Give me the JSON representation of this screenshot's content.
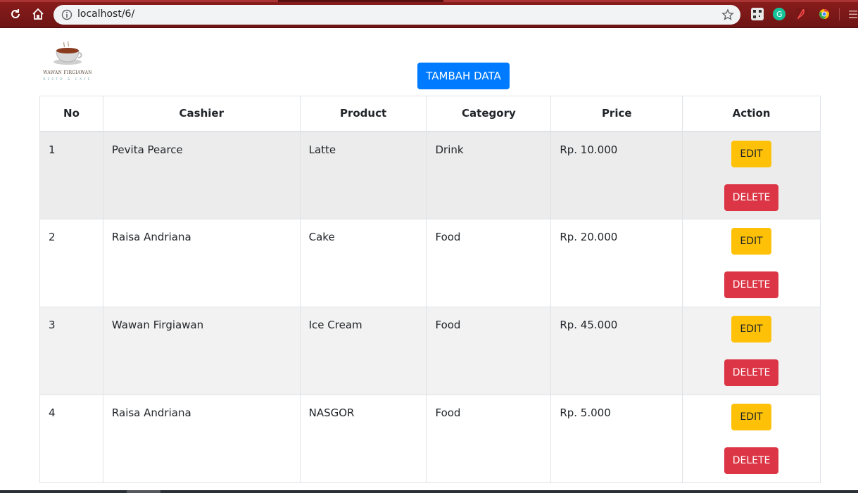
{
  "browser": {
    "url": "localhost/6/",
    "icons": [
      "reload-icon",
      "home-icon",
      "info-icon",
      "star-icon",
      "qr-extension-icon",
      "grammarly-icon",
      "pdf-extension-icon",
      "chrome-extension-icon",
      "menu-icon"
    ]
  },
  "logo": {
    "name": "WAWAN FIRGIAWAN",
    "subtitle": "RESTO & CAFE"
  },
  "add_button_label": "TAMBAH DATA",
  "table": {
    "headers": [
      "No",
      "Cashier",
      "Product",
      "Category",
      "Price",
      "Action"
    ],
    "rows": [
      {
        "no": "1",
        "cashier": "Pevita Pearce",
        "product": "Latte",
        "category": "Drink",
        "price": "Rp. 10.000"
      },
      {
        "no": "2",
        "cashier": "Raisa Andriana",
        "product": "Cake",
        "category": "Food",
        "price": "Rp. 20.000"
      },
      {
        "no": "3",
        "cashier": "Wawan Firgiawan",
        "product": "Ice Cream",
        "category": "Food",
        "price": "Rp. 45.000"
      },
      {
        "no": "4",
        "cashier": "Raisa Andriana",
        "product": "NASGOR",
        "category": "Food",
        "price": "Rp. 5.000"
      }
    ],
    "edit_label": "EDIT",
    "delete_label": "DELETE"
  },
  "colors": {
    "primary": "#007bff",
    "warning": "#ffc107",
    "danger": "#dc3545",
    "chrome": "#7a1818"
  }
}
